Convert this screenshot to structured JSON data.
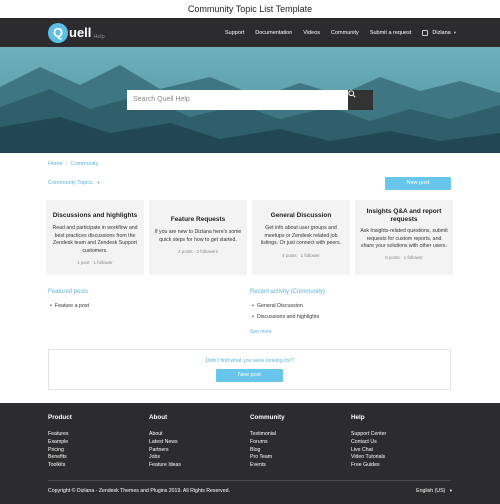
{
  "page_title": "Community Topic List Template",
  "header": {
    "logo_word": "Quell",
    "logo_letter": "Q",
    "logo_rest": "uell",
    "logo_help": "Help",
    "nav": [
      "Support",
      "Documentation",
      "Videos",
      "Community",
      "Submit a request"
    ],
    "user_name": "Dizlana",
    "caret": "▾"
  },
  "hero": {
    "search_placeholder": "Search Quell Help",
    "search_icon": "magnifier-icon"
  },
  "breadcrumb": [
    "Home",
    "Community"
  ],
  "breadcrumb_sep": "›",
  "filter": {
    "label": "Community Topics",
    "caret": "▾"
  },
  "new_post_label": "New post",
  "topics": [
    {
      "title": "Discussions and highlights",
      "desc": "Read and participate in workflow and best practices discussions from the Zendesk team and Zendesk Support customers.",
      "meta": "1 post · 1 follower"
    },
    {
      "title": "Feature Requests",
      "desc": "If you are new to Dizlana here's some quick steps for how to get started.",
      "meta": "4 posts · 2 followers"
    },
    {
      "title": "General Discussion",
      "desc": "Get info about user groups and meetups or Zendesk related job listings. Or just connect with peers.",
      "meta": "4 posts · 1 follower"
    },
    {
      "title": "Insights Q&A and report requests",
      "desc": "Ask Insights-related questions, submit requests for custom reports, and share your solutions with other users.",
      "meta": "0 posts · 1 follower"
    }
  ],
  "featured": {
    "title": "Featured posts",
    "items": [
      "Feature a post"
    ]
  },
  "recent": {
    "title": "Recent activity (Community)",
    "items": [
      "General Discussion",
      "Discussions and highlights"
    ],
    "see_more": "See more"
  },
  "cta": {
    "text": "Didn't find what you were looking for?",
    "button": "New post"
  },
  "footer": {
    "columns": [
      {
        "title": "Product",
        "links": [
          "Features",
          "Example",
          "Pricing",
          "Benefits",
          "Toolkits"
        ]
      },
      {
        "title": "About",
        "links": [
          "About",
          "Latest News",
          "Partners",
          "Jobs",
          "Feature Ideas"
        ]
      },
      {
        "title": "Community",
        "links": [
          "Testimonial",
          "Forums",
          "Blog",
          "Pro Team",
          "Events"
        ]
      },
      {
        "title": "Help",
        "links": [
          "Support Center",
          "Contact Us",
          "Live Chat",
          "Video Tutorials",
          "Free Guides"
        ]
      }
    ],
    "copyright": "Copyright © Dizlana - Zendesk Themes and Plugins 2019. All Rights Reserved.",
    "language": "English (US)",
    "language_caret": "▾"
  },
  "colors": {
    "accent": "#5cb3d8",
    "button": "#68c6ec",
    "header_bg": "#2c2c2e",
    "card_bg": "#f3f3f3"
  }
}
